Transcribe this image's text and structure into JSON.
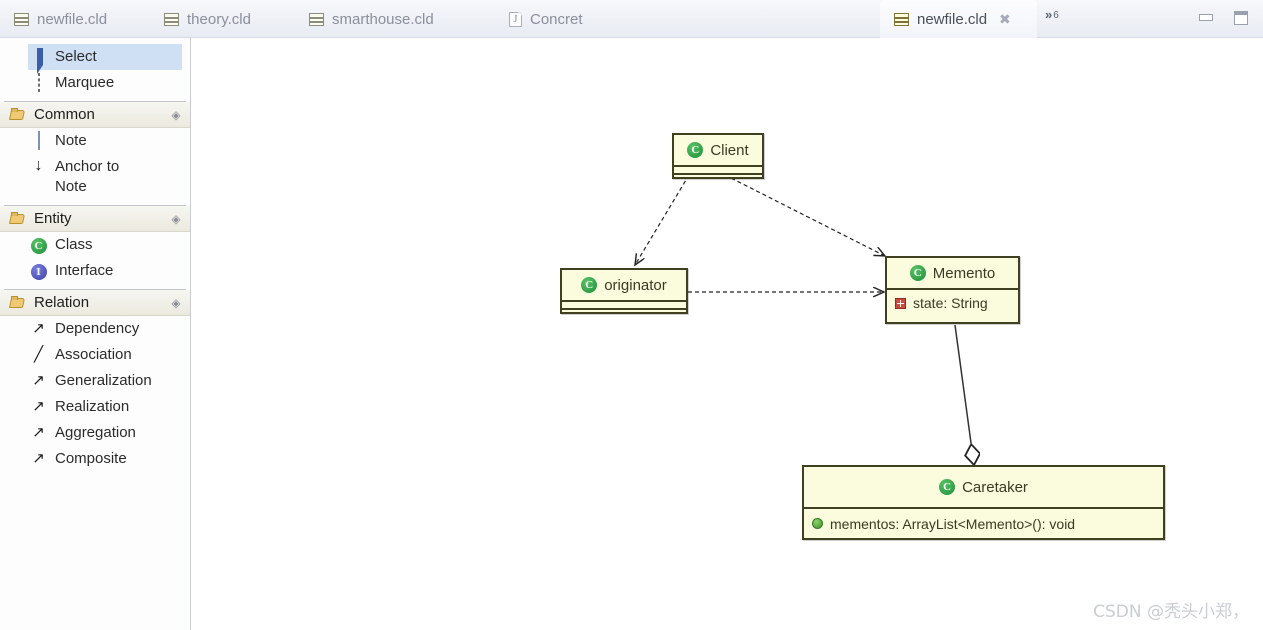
{
  "window": {
    "minimize_label": "–",
    "maximize_label": "□"
  },
  "tabs": {
    "left": [
      {
        "label": "newfile.cld",
        "icon": "cld-file-icon",
        "active": false
      },
      {
        "label": "theory.cld",
        "icon": "cld-file-icon",
        "active": false
      },
      {
        "label": "smarthouse.cld",
        "icon": "cld-file-icon",
        "active": false
      },
      {
        "label": "Concret",
        "icon": "java-file-icon",
        "active": false
      }
    ],
    "right": {
      "label": "newfile.cld",
      "icon": "cld-file-icon",
      "close_label": "✖",
      "active": true
    },
    "overflow": {
      "chevron": "»",
      "count": "6"
    }
  },
  "palette": {
    "tools": [
      {
        "label": "Select",
        "icon": "cursor-icon",
        "selected": true
      },
      {
        "label": "Marquee",
        "icon": "marquee-icon",
        "selected": false
      }
    ],
    "groups": [
      {
        "title": "Common",
        "icon": "folder-icon",
        "pin_icon": "pin-icon",
        "items": [
          {
            "label": "Note",
            "icon": "note-icon"
          },
          {
            "label": "Anchor to Note",
            "icon": "anchor-icon",
            "glyph": "↓"
          }
        ]
      },
      {
        "title": "Entity",
        "icon": "folder-icon",
        "pin_icon": "pin-icon",
        "items": [
          {
            "label": "Class",
            "icon": "class-circle-icon",
            "glyph": "C",
            "color": "green"
          },
          {
            "label": "Interface",
            "icon": "interface-circle-icon",
            "glyph": "I",
            "color": "blue"
          }
        ]
      },
      {
        "title": "Relation",
        "icon": "folder-icon",
        "pin_icon": "pin-icon",
        "items": [
          {
            "label": "Dependency",
            "icon": "dependency-arrow-icon",
            "glyph": "↗"
          },
          {
            "label": "Association",
            "icon": "association-line-icon",
            "glyph": "╱"
          },
          {
            "label": "Generalization",
            "icon": "generalization-arrow-icon",
            "glyph": "↗"
          },
          {
            "label": "Realization",
            "icon": "realization-arrow-icon",
            "glyph": "↗"
          },
          {
            "label": "Aggregation",
            "icon": "aggregation-diamond-icon",
            "glyph": "↗"
          },
          {
            "label": "Composite",
            "icon": "composite-diamond-icon",
            "glyph": "↗"
          }
        ]
      }
    ]
  },
  "diagram": {
    "classes": [
      {
        "id": "client",
        "name": "Client",
        "stereotype_icon": "class-circle-icon",
        "stereotype_glyph": "C",
        "members": []
      },
      {
        "id": "originator",
        "name": "originator",
        "stereotype_icon": "class-circle-icon",
        "stereotype_glyph": "C",
        "members": []
      },
      {
        "id": "memento",
        "name": "Memento",
        "stereotype_icon": "class-circle-icon",
        "stereotype_glyph": "C",
        "members": [
          {
            "label": "state: String",
            "visibility": "private",
            "icon": "private-square-icon"
          }
        ]
      },
      {
        "id": "caretaker",
        "name": "Caretaker",
        "stereotype_icon": "class-circle-icon",
        "stereotype_glyph": "C",
        "members": [
          {
            "label": "mementos: ArrayList<Memento>(): void",
            "visibility": "public",
            "icon": "public-dot-icon"
          }
        ]
      }
    ],
    "relations": [
      {
        "from": "client",
        "to": "originator",
        "type": "dependency",
        "style": "dashed",
        "arrow": "open"
      },
      {
        "from": "client",
        "to": "memento",
        "type": "dependency",
        "style": "dashed",
        "arrow": "open"
      },
      {
        "from": "originator",
        "to": "memento",
        "type": "dependency",
        "style": "dashed",
        "arrow": "open"
      },
      {
        "from": "memento",
        "to": "caretaker",
        "type": "aggregation",
        "style": "solid",
        "arrow": "hollow-diamond"
      }
    ]
  },
  "watermark": {
    "text": "CSDN @秃头小郑，"
  },
  "colors": {
    "class_fill": "#fbfbdd",
    "class_border": "#3f3f22",
    "selection": "#cfe0f5",
    "accent_green": "#1d8f3a"
  }
}
